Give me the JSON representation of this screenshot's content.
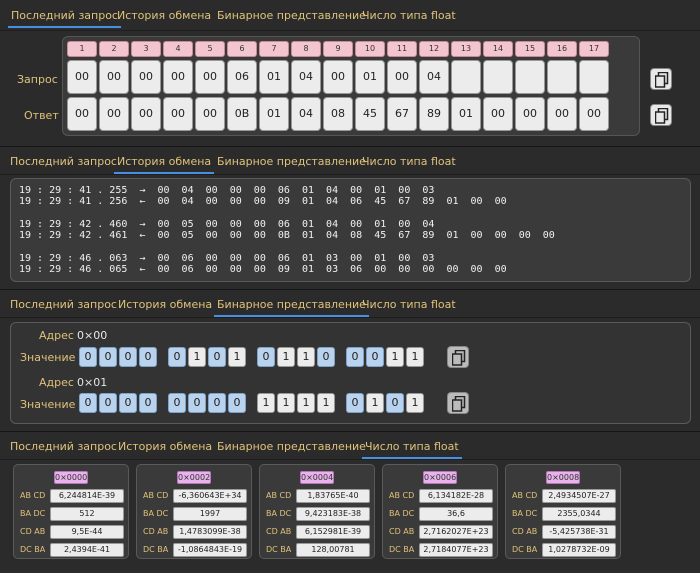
{
  "tabs": [
    "Последний запрос",
    "История обмена",
    "Бинарное представление",
    "Число типа float"
  ],
  "last_request": {
    "row_labels": [
      "Запрос",
      "Ответ"
    ],
    "indices": [
      "1",
      "2",
      "3",
      "4",
      "5",
      "6",
      "7",
      "8",
      "9",
      "10",
      "11",
      "12",
      "13",
      "14",
      "15",
      "16",
      "17"
    ],
    "request": [
      "00",
      "00",
      "00",
      "00",
      "00",
      "06",
      "01",
      "04",
      "00",
      "01",
      "00",
      "04",
      "",
      "",
      "",
      "",
      ""
    ],
    "response": [
      "00",
      "00",
      "00",
      "00",
      "00",
      "0B",
      "01",
      "04",
      "08",
      "45",
      "67",
      "89",
      "01",
      "00",
      "00",
      "00",
      "00"
    ]
  },
  "history": [
    "19 : 29 : 41 . 255  →  00  04  00  00  00  06  01  04  00  01  00  03",
    "19 : 29 : 41 . 256  ←  00  04  00  00  00  09  01  04  06  45  67  89  01  00  00",
    "19 : 29 : 42 . 460  →  00  05  00  00  00  06  01  04  00  01  00  04",
    "19 : 29 : 42 . 461  ←  00  05  00  00  00  0B  01  04  08  45  67  89  01  00  00  00  00",
    "19 : 29 : 46 . 063  →  00  06  00  00  00  06  01  03  00  01  00  03",
    "19 : 29 : 46 . 065  ←  00  06  00  00  00  09  01  03  06  00  00  00  00  00  00"
  ],
  "binary": {
    "address_label": "Адрес",
    "value_label": "Значение",
    "registers": [
      {
        "address": "0×00",
        "bits": [
          "0",
          "0",
          "0",
          "0",
          "0",
          "1",
          "0",
          "1",
          "0",
          "1",
          "1",
          "0",
          "0",
          "0",
          "1",
          "1"
        ]
      },
      {
        "address": "0×01",
        "bits": [
          "0",
          "0",
          "0",
          "0",
          "0",
          "0",
          "0",
          "0",
          "1",
          "1",
          "1",
          "1",
          "0",
          "1",
          "0",
          "1"
        ]
      }
    ]
  },
  "float": {
    "row_labels": [
      "AB CD",
      "BA DC",
      "CD AB",
      "DC BA"
    ],
    "panels": [
      {
        "address": "0×0000",
        "values": [
          "6,244814E-39",
          "512",
          "9,5E-44",
          "2,4394E-41"
        ]
      },
      {
        "address": "0×0002",
        "values": [
          "-6,360643E+34",
          "1997",
          "1,4783099E-38",
          "-1,0864843E-19"
        ]
      },
      {
        "address": "0×0004",
        "values": [
          "1,83765E-40",
          "9,423183E-38",
          "6,152981E-39",
          "128,00781"
        ]
      },
      {
        "address": "0×0006",
        "values": [
          "6,134182E-28",
          "36,6",
          "2,7162027E+23",
          "2,7184077E+23"
        ]
      },
      {
        "address": "0×0008",
        "values": [
          "2,4934507E-27",
          "2355,0344",
          "-5,425738E-31",
          "1,0278732E-09"
        ]
      }
    ]
  },
  "icons": {
    "copy": "copy-icon"
  },
  "colors": {
    "accent": "#4a90e2",
    "label": "#e0c27a",
    "index_bg": "#f3c6cf",
    "bit_zero_bg": "#b9d3ee",
    "float_addr_bg": "#e7b3ea"
  }
}
